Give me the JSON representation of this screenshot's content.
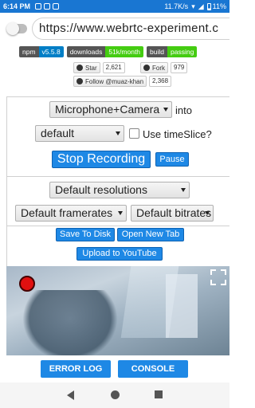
{
  "status": {
    "time": "6:14 PM",
    "speed": "11.7K/s",
    "battery": "11%"
  },
  "browser": {
    "url": "https://www.webrtc-experiment.c"
  },
  "badges": [
    {
      "label": "npm",
      "value": "v5.5.8"
    },
    {
      "label": "downloads",
      "value": "51k/month"
    },
    {
      "label": "build",
      "value": "passing"
    }
  ],
  "github": {
    "star_label": "Star",
    "star_count": "2,621",
    "fork_label": "Fork",
    "fork_count": "979",
    "follow_label": "Follow @muaz-khan",
    "follow_count": "2,368"
  },
  "recorder": {
    "source_select": "Microphone+Camera",
    "into_text": "into",
    "mime_select": "default",
    "timeslice_label": "Use timeSlice?",
    "stop_button": "Stop Recording",
    "pause_button": "Pause"
  },
  "options": {
    "resolution_select": "Default resolutions",
    "framerate_select": "Default framerates",
    "bitrate_select": "Default bitrates"
  },
  "actions": {
    "save_disk": "Save To Disk",
    "open_tab": "Open New Tab",
    "upload_youtube": "Upload to YouTube"
  },
  "bottom": {
    "error_log": "ERROR LOG",
    "console": "CONSOLE"
  }
}
